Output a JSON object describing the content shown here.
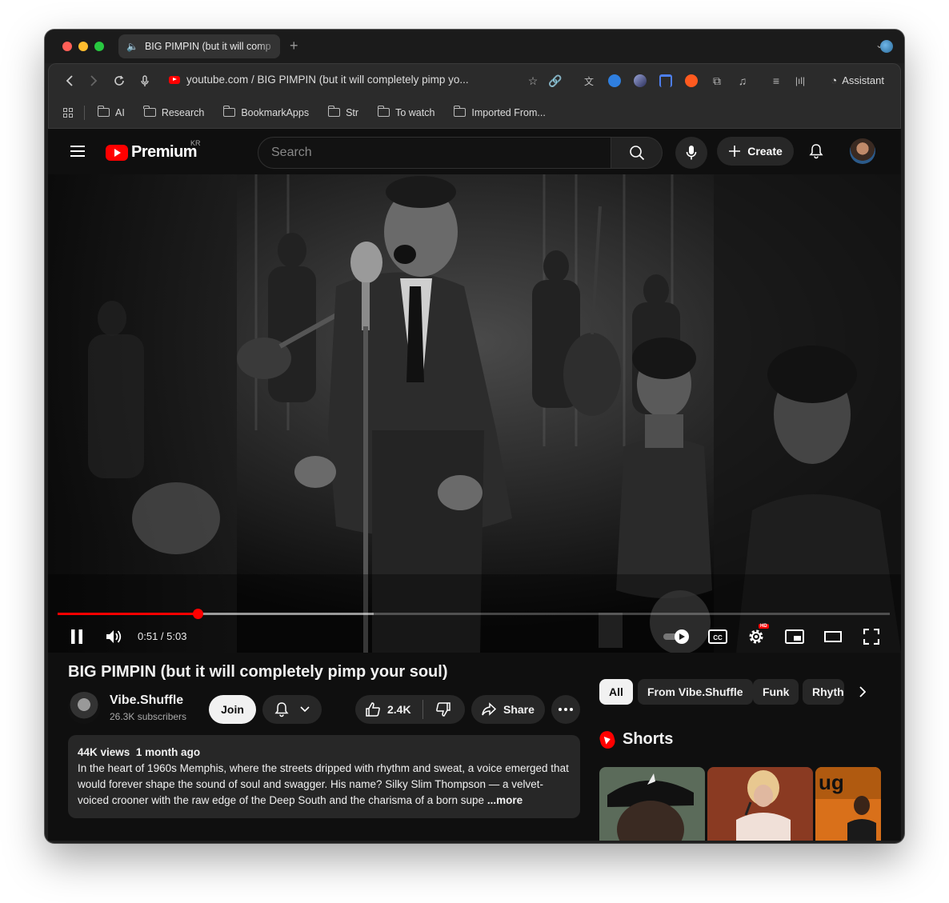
{
  "browser": {
    "tab_title": "BIG PIMPIN (but it will comp",
    "new_tab_symbol": "+",
    "url_text": "youtube.com / BIG PIMPIN (but it will completely pimp yo...",
    "assistant_label": "Assistant",
    "bookmarks": [
      "AI",
      "Research",
      "BookmarkApps",
      "Str",
      "To watch",
      "Imported From..."
    ]
  },
  "youtube": {
    "logo_text": "Premium",
    "region": "KR",
    "search_placeholder": "Search",
    "create_label": "Create"
  },
  "player": {
    "current_time": "0:51",
    "duration": "5:03",
    "time_display": "0:51 / 5:03",
    "played_fraction": 0.168,
    "buffered_fraction": 0.38,
    "hd_badge": "HD"
  },
  "video": {
    "title": "BIG PIMPIN (but it will completely pimp your soul)",
    "channel_name": "Vibe.Shuffle",
    "subscribers": "26.3K subscribers",
    "join_label": "Join",
    "likes": "2.4K",
    "share_label": "Share",
    "views": "44K views",
    "uploaded": "1 month ago",
    "description": "In the heart of 1960s Memphis, where the streets dripped with rhythm and sweat, a voice emerged that would forever shape the sound of soul and swagger. His name? Silky Slim Thompson — a velvet-voiced crooner with the raw edge of the Deep South and the charisma of a born supe",
    "more_label": "...more"
  },
  "sidebar": {
    "chips": [
      "All",
      "From Vibe.Shuffle",
      "Funk",
      "Rhyth"
    ],
    "shorts_title": "Shorts"
  },
  "colors": {
    "brand_red": "#ff0000",
    "page_bg": "#0f0f0f",
    "chip_bg": "#272727"
  }
}
